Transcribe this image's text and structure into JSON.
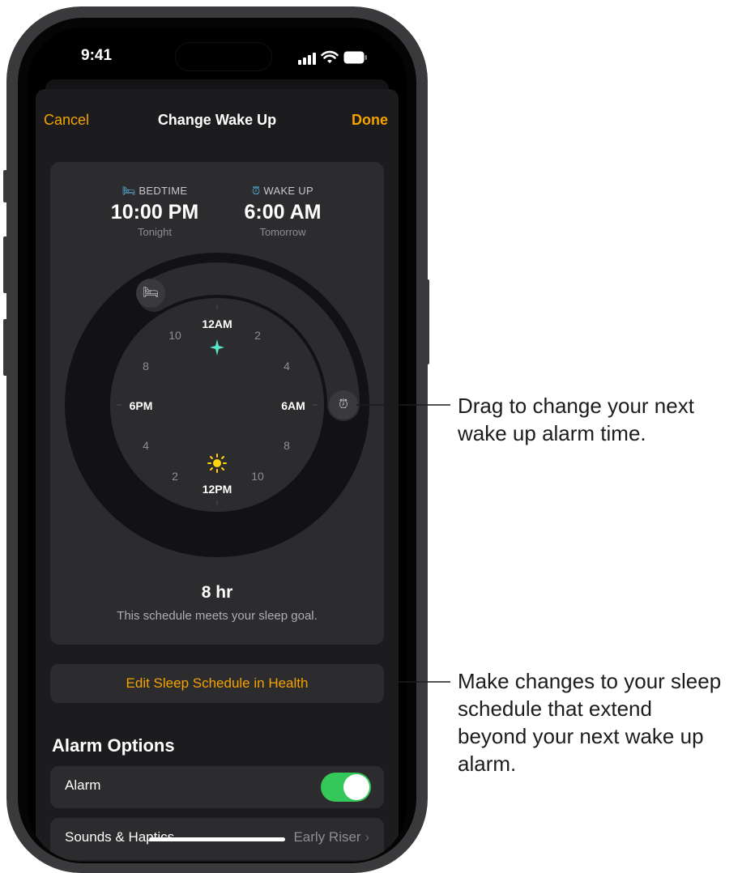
{
  "status_bar": {
    "time": "9:41"
  },
  "nav": {
    "cancel": "Cancel",
    "title": "Change Wake Up",
    "done": "Done"
  },
  "schedule": {
    "bedtime_label": "BEDTIME",
    "bedtime_time": "10:00 PM",
    "bedtime_day": "Tonight",
    "wakeup_label": "WAKE UP",
    "wakeup_time": "6:00 AM",
    "wakeup_day": "Tomorrow"
  },
  "clock": {
    "main_labels": {
      "top": "12AM",
      "right": "6AM",
      "bottom": "12PM",
      "left": "6PM"
    },
    "minor_labels": [
      "2",
      "4",
      "8",
      "10",
      "2",
      "4",
      "8",
      "10"
    ]
  },
  "summary": {
    "duration": "8 hr",
    "goal_text": "This schedule meets your sleep goal."
  },
  "edit_button": "Edit Sleep Schedule in Health",
  "alarm_options": {
    "title": "Alarm Options",
    "alarm_label": "Alarm",
    "alarm_on": true,
    "sounds_label": "Sounds & Haptics",
    "sounds_value": "Early Riser"
  },
  "callouts": {
    "wake_handle": "Drag to change your next wake up alarm time.",
    "edit_schedule": "Make changes to your sleep schedule that extend beyond your next wake up alarm."
  },
  "colors": {
    "accent": "#f4a300",
    "toggle_on": "#34c759",
    "bedtime_icon": "#5ac8fa",
    "wake_icon": "#5ac8fa"
  }
}
